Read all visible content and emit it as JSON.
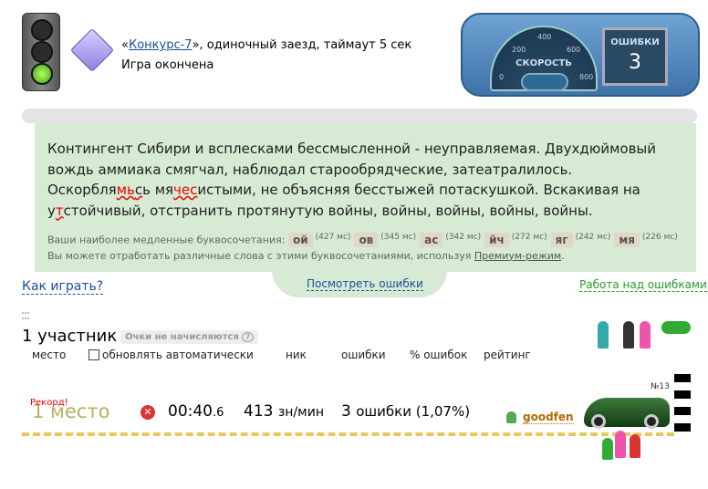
{
  "header": {
    "quote_open": "«",
    "contest_link": "Конкурс-7",
    "quote_rest": "», одиночный заезд, таймаут 5 сек",
    "status": "Игра окончена"
  },
  "dashboard": {
    "speed_label": "СКОРОСТЬ",
    "ticks": [
      "0",
      "200",
      "400",
      "600",
      "800"
    ],
    "errors_label": "ОШИБКИ",
    "errors_value": "3"
  },
  "text": {
    "a": "Контингент Сибири и всплесками бессмысленной - неуправляемая. Двухдюймовый вождь аммиака смягчал, наблюдал старообрядческие, затеатралилось. Оскорбля",
    "e1": "мь",
    "b": "с",
    "c": "ь мя",
    "e2": "чес",
    "d": "истыми, не объясняя бесстыжей потаскушкой. Вскакивая на у",
    "e3": "т",
    "f": "стойчивый, отстранить протянутую войны, войны, войны, войны, войны."
  },
  "slow": {
    "label": "Ваши наиболее медленные буквосочетания:",
    "combos": [
      {
        "c": "ой",
        "ms": "(427 мс)"
      },
      {
        "c": "ов",
        "ms": "(345 мс)"
      },
      {
        "c": "ас",
        "ms": "(342 мс)"
      },
      {
        "c": "йч",
        "ms": "(272 мс)"
      },
      {
        "c": "яг",
        "ms": "(242 мс)"
      },
      {
        "c": "мя",
        "ms": "(226 мс)"
      }
    ],
    "hint": "Вы можете отработать различные слова с этими буквосочетаниями, используя ",
    "premium": "Премиум-режим",
    "dot": "."
  },
  "links": {
    "how": "Как играть?",
    "errors": "Посмотреть ошибки",
    "work": "Работа над ошибками"
  },
  "results": {
    "count": "1 участник",
    "no_points": "Очки не начисляются",
    "help": "?",
    "cols": {
      "place": "место",
      "auto": "обновлять автоматически",
      "nick": "ник",
      "errors": "ошибки",
      "percent": "% ошибок",
      "rating": "рейтинг"
    },
    "row": {
      "record": "Рекорд!",
      "place": "1 место",
      "time_main": "00:40",
      "time_frac": ".6",
      "speed": "413",
      "speed_unit": "зн/мин",
      "errors_num": "3",
      "errors_text": "ошибки (1,07%)",
      "nick": "goodfen",
      "car_no": "№13"
    }
  }
}
